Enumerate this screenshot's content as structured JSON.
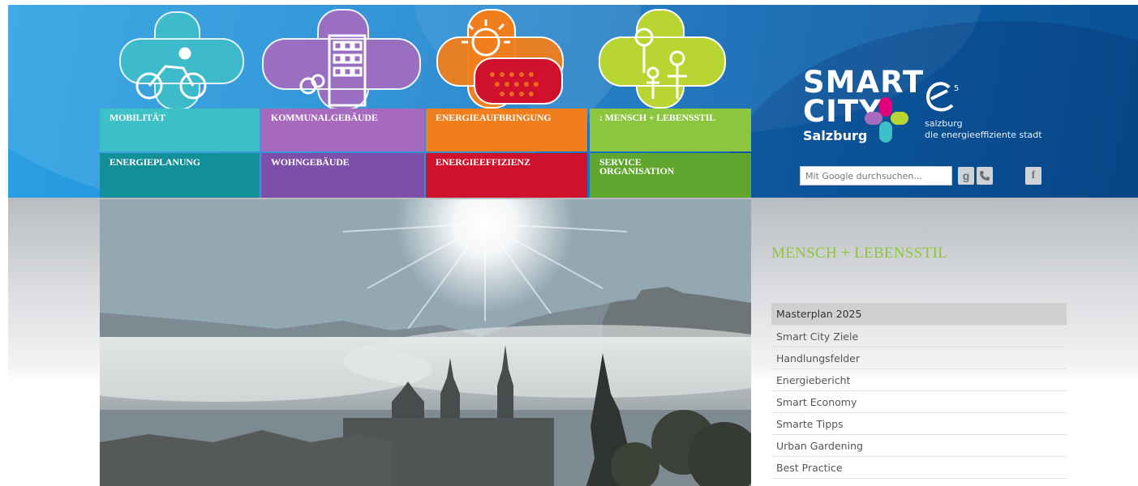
{
  "nav": {
    "top_row": [
      {
        "label": "MOBILITÄT",
        "color": "#3ec0c7"
      },
      {
        "label": "KOMMUNALGEBÄUDE",
        "color": "#a66bbf"
      },
      {
        "label": "ENERGIEAUFBRINGUNG",
        "color": "#f07e1d"
      },
      {
        "label": ": MENSCH + LEBENSSTIL",
        "color": "#8cc63f"
      }
    ],
    "bottom_row": [
      {
        "label": "ENERGIEPLANUNG",
        "color": "#138f98"
      },
      {
        "label": "WOHNGEBÄUDE",
        "color": "#7c4fa8"
      },
      {
        "label": "ENERGIEEFFIZIENZ",
        "color": "#d0112b"
      },
      {
        "label": "SERVICE\nORGANISATION",
        "color": "#5fa52e"
      }
    ]
  },
  "logo": {
    "smart": "SMART",
    "city": "CITY",
    "salzburg": "Salzburg",
    "e5_city": "salzburg",
    "e5_tagline": "die energieeffiziente stadt"
  },
  "search": {
    "placeholder": "Mit Google durchsuchen..."
  },
  "icons": {
    "google": "g",
    "phone": "phone-icon",
    "facebook": "f"
  },
  "sidebar": {
    "title": "MENSCH + LEBENSSTIL",
    "items": [
      "Masterplan 2025",
      "Smart City Ziele",
      "Handlungsfelder",
      "Energiebericht",
      "Smart Economy",
      "Smarte Tipps",
      "Urban Gardening",
      "Best Practice"
    ]
  }
}
